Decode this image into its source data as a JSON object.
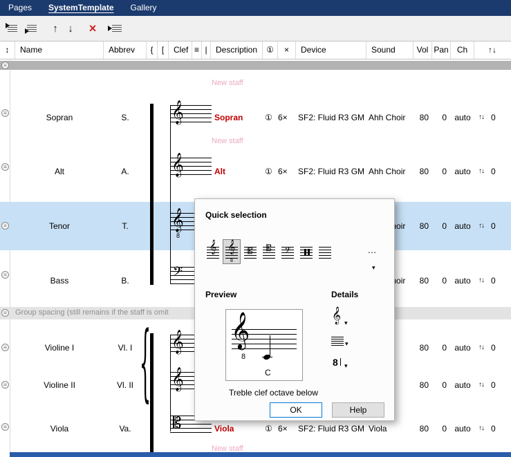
{
  "tabs": [
    {
      "label": "Pages",
      "active": false
    },
    {
      "label": "SystemTemplate",
      "active": true
    },
    {
      "label": "Gallery",
      "active": false
    }
  ],
  "icons": {
    "up": "↑",
    "down": "↓",
    "delete": "×",
    "updown": "↑↓",
    "resize": "↕",
    "dropdown": "▾",
    "lines": "≡",
    "handle": "≡"
  },
  "header": {
    "name": "Name",
    "abbrev": "Abbrev",
    "brace": "{",
    "bracket": "[",
    "clef": "Clef",
    "barline": "|",
    "description": "Description",
    "info": "①",
    "times": "×",
    "device": "Device",
    "sound": "Sound",
    "vol": "Vol",
    "pan": "Pan",
    "ch": "Ch"
  },
  "labels": {
    "new_staff": "New staff",
    "group_spacing": "Group spacing (still remains if the staff is omit"
  },
  "rows": [
    {
      "name": "Sopran",
      "abbrev": "S.",
      "clef": "treble",
      "glyph": "𝄞",
      "desc": "Sopran",
      "info": "①",
      "times": "6×",
      "device": "SF2: Fluid R3 GM",
      "sound": "Ahh Choir",
      "vol": "80",
      "pan": "0",
      "ch": "auto",
      "transpose": "0"
    },
    {
      "name": "Alt",
      "abbrev": "A.",
      "clef": "treble",
      "glyph": "𝄞",
      "desc": "Alt",
      "info": "①",
      "times": "6×",
      "device": "SF2: Fluid R3 GM",
      "sound": "Ahh Choir",
      "vol": "80",
      "pan": "0",
      "ch": "auto",
      "transpose": "0"
    },
    {
      "name": "Tenor",
      "abbrev": "T.",
      "clef": "treble-8",
      "glyph": "𝄞",
      "clef_sub": "8",
      "desc": "",
      "info": "",
      "times": "",
      "device": "",
      "sound": "Ahh Choir",
      "vol": "80",
      "pan": "0",
      "ch": "auto",
      "transpose": "0"
    },
    {
      "name": "Bass",
      "abbrev": "B.",
      "clef": "bass",
      "glyph": "𝄢",
      "desc": "",
      "info": "",
      "times": "",
      "device": "",
      "sound": "Ahh Choir",
      "vol": "80",
      "pan": "0",
      "ch": "auto",
      "transpose": "0"
    },
    {
      "name": "Violine I",
      "abbrev": "Vl. I",
      "clef": "treble",
      "glyph": "𝄞",
      "desc": "",
      "info": "",
      "times": "",
      "device": "",
      "sound": "",
      "vol": "80",
      "pan": "0",
      "ch": "auto",
      "transpose": "0"
    },
    {
      "name": "Violine II",
      "abbrev": "Vl. II",
      "clef": "treble",
      "glyph": "𝄞",
      "desc": "",
      "info": "",
      "times": "",
      "device": "",
      "sound": "",
      "vol": "80",
      "pan": "0",
      "ch": "auto",
      "transpose": "0"
    },
    {
      "name": "Viola",
      "abbrev": "Va.",
      "clef": "alto",
      "glyph": "𝄡",
      "desc": "Viola",
      "info": "①",
      "times": "6×",
      "device": "SF2: Fluid R3 GM",
      "sound": "Viola",
      "vol": "80",
      "pan": "0",
      "ch": "auto",
      "transpose": "0"
    }
  ],
  "dialog": {
    "title": "Quick selection",
    "clefs": [
      {
        "name": "treble-clef",
        "glyph": "𝄞",
        "selected": false
      },
      {
        "name": "treble-clef-octave-below",
        "glyph": "𝄞",
        "sub": "8",
        "selected": true
      },
      {
        "name": "alto-clef",
        "glyph": "𝄡",
        "selected": false
      },
      {
        "name": "tenor-clef",
        "glyph": "𝄡",
        "selected": false
      },
      {
        "name": "bass-clef",
        "glyph": "𝄢",
        "selected": false
      },
      {
        "name": "percussion-clef",
        "glyph": "",
        "selected": false
      },
      {
        "name": "no-clef",
        "glyph": "",
        "selected": false
      }
    ],
    "more": "…",
    "preview_label": "Preview",
    "details_label": "Details",
    "preview": {
      "clef_glyph": "𝄞",
      "sub": "8",
      "note_label": "C"
    },
    "details": {
      "clef_glyph": "𝄞",
      "octave_glyph": "8"
    },
    "clef_name": "Treble clef octave below",
    "ok": "OK",
    "help": "Help"
  },
  "colors": {
    "tabbar": "#1b3a6d",
    "selection": "#c8e0f5",
    "description_red": "#c00000",
    "new_staff_pink": "#eba9c0",
    "ok_border_blue": "#0078d7"
  }
}
